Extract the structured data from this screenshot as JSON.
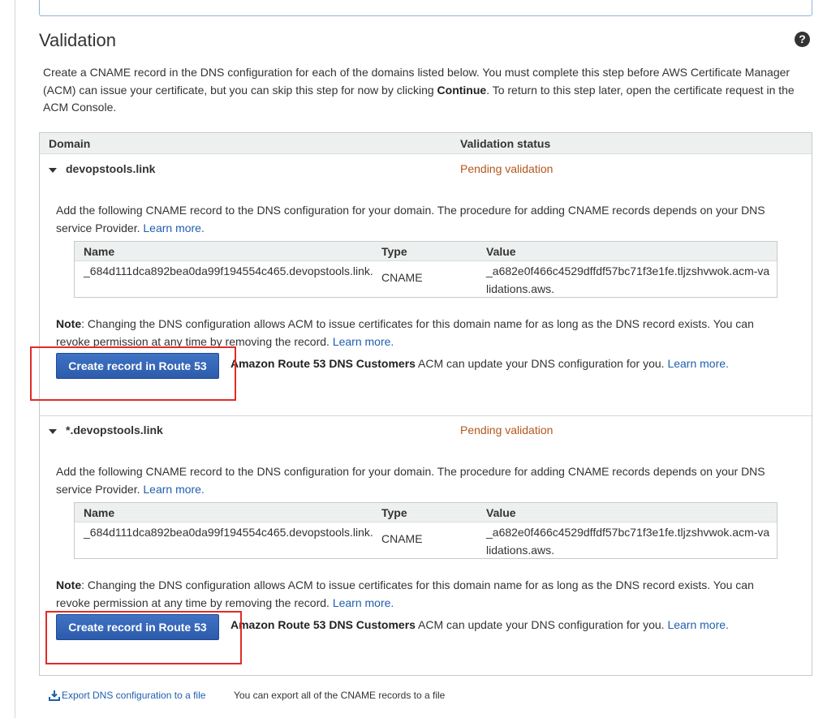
{
  "section": {
    "title": "Validation",
    "help_icon": "question-circle-icon"
  },
  "intro": {
    "text_before": "Create a CNAME record in the DNS configuration for each of the domains listed below. You must complete this step before AWS Certificate Manager (ACM) can issue your certificate, but you can skip this step for now by clicking ",
    "bold": "Continue",
    "text_after": ". To return to this step later, open the certificate request in the ACM Console."
  },
  "table": {
    "col_domain": "Domain",
    "col_status": "Validation status"
  },
  "domains": [
    {
      "name": "devopstools.link",
      "status": "Pending validation",
      "desc": "Add the following CNAME record to the DNS configuration for your domain. The procedure for adding CNAME records depends on your DNS service Provider. ",
      "desc_link": "Learn more.",
      "cname": {
        "h_name": "Name",
        "h_type": "Type",
        "h_value": "Value",
        "name": "_684d111dca892bea0da99f194554c465.devopstools.link.",
        "type": "CNAME",
        "value": "_a682e0f466c4529dffdf57bc71f3e1fe.tljzshvwok.acm-validations.aws."
      },
      "note_label": "Note",
      "note_text": ": Changing the DNS configuration allows ACM to issue certificates for this domain name for as long as the DNS record exists. You can revoke permission at any time by removing the record. ",
      "note_link": "Learn more.",
      "button": "Create record in Route 53",
      "route53_bold": "Amazon Route 53 DNS Customers",
      "route53_text": " ACM can update your DNS configuration for you. ",
      "route53_link": "Learn more."
    },
    {
      "name": "*.devopstools.link",
      "status": "Pending validation",
      "desc": "Add the following CNAME record to the DNS configuration for your domain. The procedure for adding CNAME records depends on your DNS service Provider. ",
      "desc_link": "Learn more.",
      "cname": {
        "h_name": "Name",
        "h_type": "Type",
        "h_value": "Value",
        "name": "_684d111dca892bea0da99f194554c465.devopstools.link.",
        "type": "CNAME",
        "value": "_a682e0f466c4529dffdf57bc71f3e1fe.tljzshvwok.acm-validations.aws."
      },
      "note_label": "Note",
      "note_text": ": Changing the DNS configuration allows ACM to issue certificates for this domain name for as long as the DNS record exists. You can revoke permission at any time by removing the record. ",
      "note_link": "Learn more.",
      "button": "Create record in Route 53",
      "route53_bold": "Amazon Route 53 DNS Customers",
      "route53_text": " ACM can update your DNS configuration for you. ",
      "route53_link": "Learn more."
    }
  ],
  "footer": {
    "export_icon": "download-icon",
    "export_link": "Export DNS configuration to a file",
    "export_desc": "You can export all of the CNAME records to a file"
  },
  "colors": {
    "pending": "#b4561c",
    "link": "#1f5fae",
    "button": "#2d5bab",
    "highlight": "#e12b2b"
  }
}
